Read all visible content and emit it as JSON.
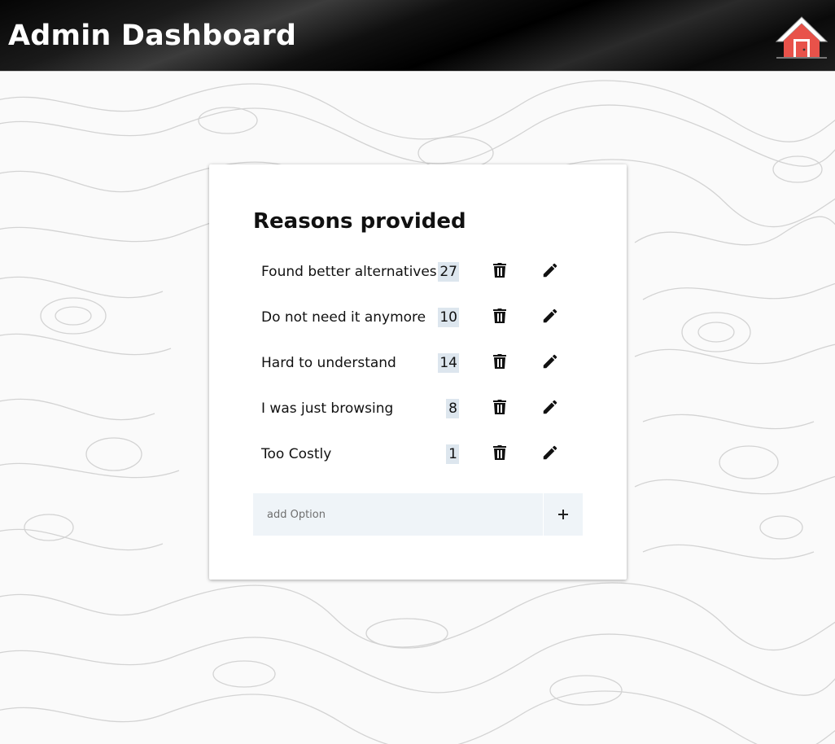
{
  "header": {
    "title": "Admin Dashboard",
    "home_icon": "home-icon"
  },
  "card": {
    "title": "Reasons provided",
    "reasons": [
      {
        "label": "Found better alternatives",
        "count": "27"
      },
      {
        "label": "Do not need it anymore",
        "count": "10"
      },
      {
        "label": "Hard to understand",
        "count": "14"
      },
      {
        "label": "I was just browsing",
        "count": "8"
      },
      {
        "label": "Too Costly",
        "count": "1"
      }
    ],
    "row_icons": [
      "trash-icon",
      "pencil-icon"
    ],
    "add_option": {
      "placeholder": "add Option",
      "icon": "plus-icon"
    }
  },
  "colors": {
    "header_bg": "#000000",
    "count_bg": "#dde6ee",
    "add_bg": "#eff4f8",
    "house_red": "#e8524a"
  }
}
